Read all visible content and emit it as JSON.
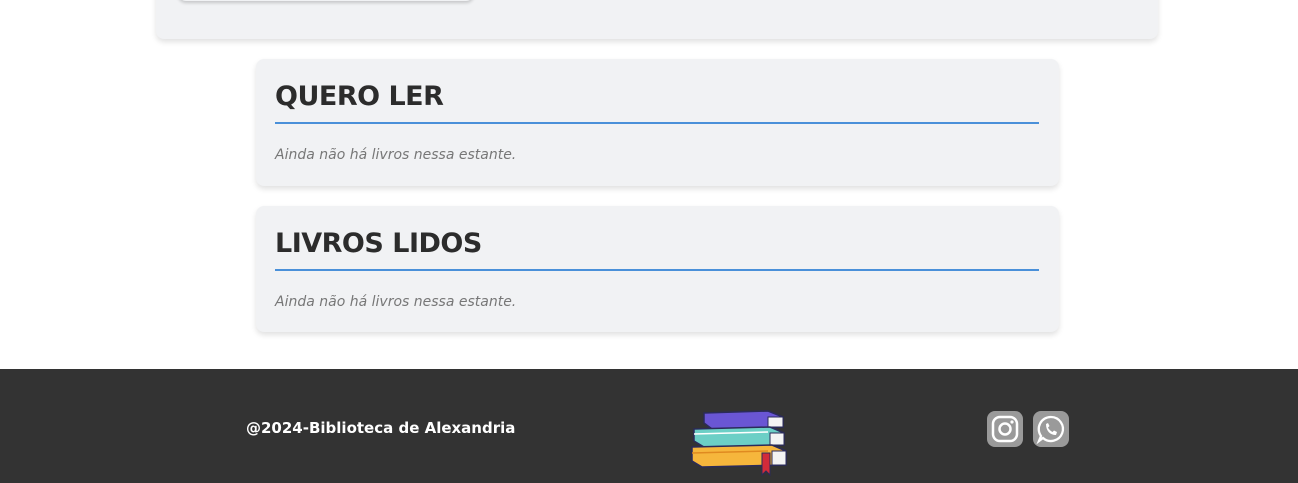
{
  "shelves": [
    {
      "title": "QUERO LER",
      "empty_message": "Ainda não há livros nessa estante."
    },
    {
      "title": "LIVROS LIDOS",
      "empty_message": "Ainda não há livros nessa estante."
    }
  ],
  "footer": {
    "copyright": "@2024-Biblioteca de Alexandria",
    "logo_icon": "books-stack-icon",
    "social": [
      "instagram-icon",
      "whatsapp-icon"
    ]
  },
  "colors": {
    "accent": "#4a90d9",
    "card_bg": "#f1f2f4",
    "footer_bg": "#333333"
  }
}
